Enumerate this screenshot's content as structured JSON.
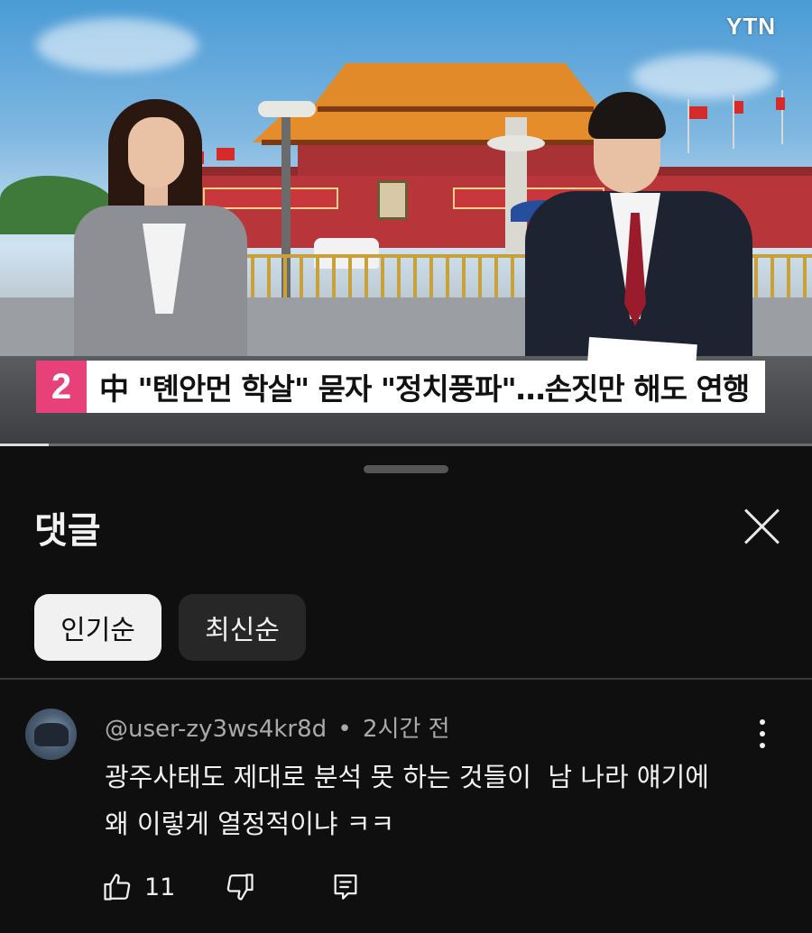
{
  "video": {
    "brand": "YTN",
    "headline_number": "2",
    "headline": "中 \"톈안먼 학살\" 묻자 \"정치풍파\"…손짓만 해도 연행",
    "progress": 0.06
  },
  "comments_sheet": {
    "title": "댓글",
    "sort_chips": [
      {
        "label": "인기순",
        "active": true
      },
      {
        "label": "최신순",
        "active": false
      }
    ],
    "comments": [
      {
        "author": "@user-zy3ws4kr8d",
        "separator": "•",
        "time": "2시간 전",
        "text_lines": [
          "광주사태도 제대로 분석 못 하는 것들이  남 나라 얘기에",
          "왜 이렇게 열정적이냐 ㅋㅋ"
        ],
        "likes": "11",
        "icons": {
          "like": "thumbs-up-icon",
          "dislike": "thumbs-down-icon",
          "reply": "reply-icon",
          "more": "more-vert-icon"
        }
      }
    ]
  },
  "colors": {
    "background": "#0f0f0f",
    "chip_active_bg": "#f1f1f1",
    "chip_idle_bg": "#272727",
    "headline_number_bg": "#e8417a",
    "meta_text": "#aaaaaa"
  }
}
